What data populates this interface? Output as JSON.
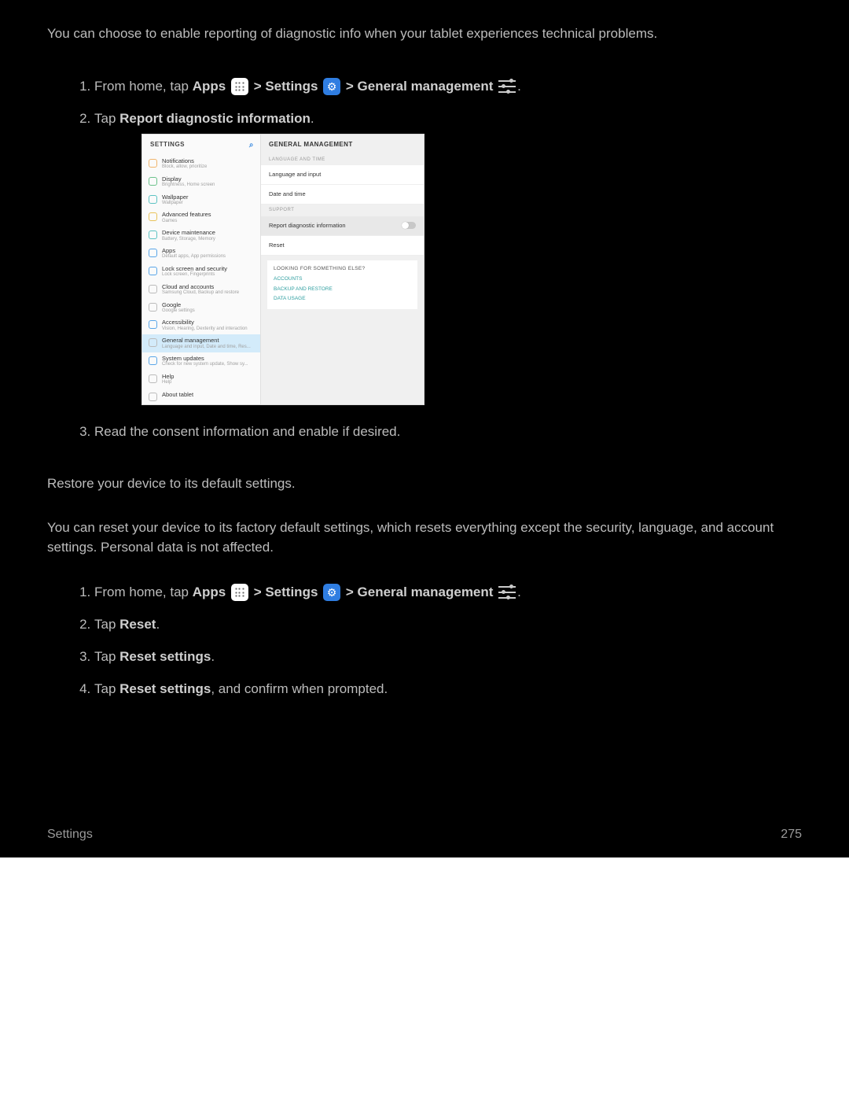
{
  "intro_text": "You can choose to enable reporting of diagnostic info when your tablet experiences technical problems.",
  "steps1": {
    "s1_prefix": "From home, tap ",
    "s1_apps": "Apps",
    "s1_gt1": " > ",
    "s1_settings": "Settings",
    "s1_gt2": " > ",
    "s1_gm": "General management",
    "s2_prefix": "Tap ",
    "s2_bold": "Report diagnostic information",
    "s2_suffix": ".",
    "s3": "Read the consent information and enable if desired."
  },
  "reset_intro": "Restore your device to its default settings.",
  "reset_desc": "You can reset your device to its factory default settings, which resets everything except the security, language, and account settings. Personal data is not affected.",
  "steps2": {
    "s1_prefix": "From home, tap ",
    "s1_apps": "Apps",
    "s1_gt1": " > ",
    "s1_settings": "Settings",
    "s1_gt2": " > ",
    "s1_gm": "General management",
    "s2_prefix": "Tap ",
    "s2_bold": "Reset",
    "s2_suffix": ".",
    "s3_prefix": "Tap ",
    "s3_bold": "Reset settings",
    "s3_suffix": ".",
    "s4_prefix": "Tap ",
    "s4_bold": "Reset settings",
    "s4_suffix": ", and confirm when prompted."
  },
  "footer": {
    "left": "Settings",
    "right": "275"
  },
  "tablet": {
    "sidebar_title": "SETTINGS",
    "items": [
      {
        "title": "Notifications",
        "sub": "Block, allow, prioritize",
        "iconClass": "ic-orange"
      },
      {
        "title": "Display",
        "sub": "Brightness, Home screen",
        "iconClass": "ic-green"
      },
      {
        "title": "Wallpaper",
        "sub": "Wallpaper",
        "iconClass": "ic-teal"
      },
      {
        "title": "Advanced features",
        "sub": "Games",
        "iconClass": "ic-yellow"
      },
      {
        "title": "Device maintenance",
        "sub": "Battery, Storage, Memory",
        "iconClass": "ic-teal"
      },
      {
        "title": "Apps",
        "sub": "Default apps, App permissions",
        "iconClass": "ic-blue2"
      },
      {
        "title": "Lock screen and security",
        "sub": "Lock screen, Fingerprints",
        "iconClass": "ic-blue2"
      },
      {
        "title": "Cloud and accounts",
        "sub": "Samsung Cloud, Backup and restore",
        "iconClass": "ic-gray"
      },
      {
        "title": "Google",
        "sub": "Google settings",
        "iconClass": "ic-gray"
      },
      {
        "title": "Accessibility",
        "sub": "Vision, Hearing, Dexterity and interaction",
        "iconClass": "ic-blue3"
      },
      {
        "title": "General management",
        "sub": "Language and input, Date and time, Res...",
        "iconClass": "ic-gray",
        "active": true
      },
      {
        "title": "System updates",
        "sub": "Check for new system update, Show sy...",
        "iconClass": "ic-blue2"
      },
      {
        "title": "Help",
        "sub": "Help",
        "iconClass": "ic-gray"
      },
      {
        "title": "About tablet",
        "sub": "",
        "iconClass": "ic-gray"
      }
    ],
    "panel": {
      "title": "GENERAL MANAGEMENT",
      "section1": "LANGUAGE AND TIME",
      "row1": "Language and input",
      "row2": "Date and time",
      "section2": "SUPPORT",
      "row3": "Report diagnostic information",
      "row4": "Reset",
      "links_title": "LOOKING FOR SOMETHING ELSE?",
      "link1": "ACCOUNTS",
      "link2": "BACKUP AND RESTORE",
      "link3": "DATA USAGE"
    }
  }
}
